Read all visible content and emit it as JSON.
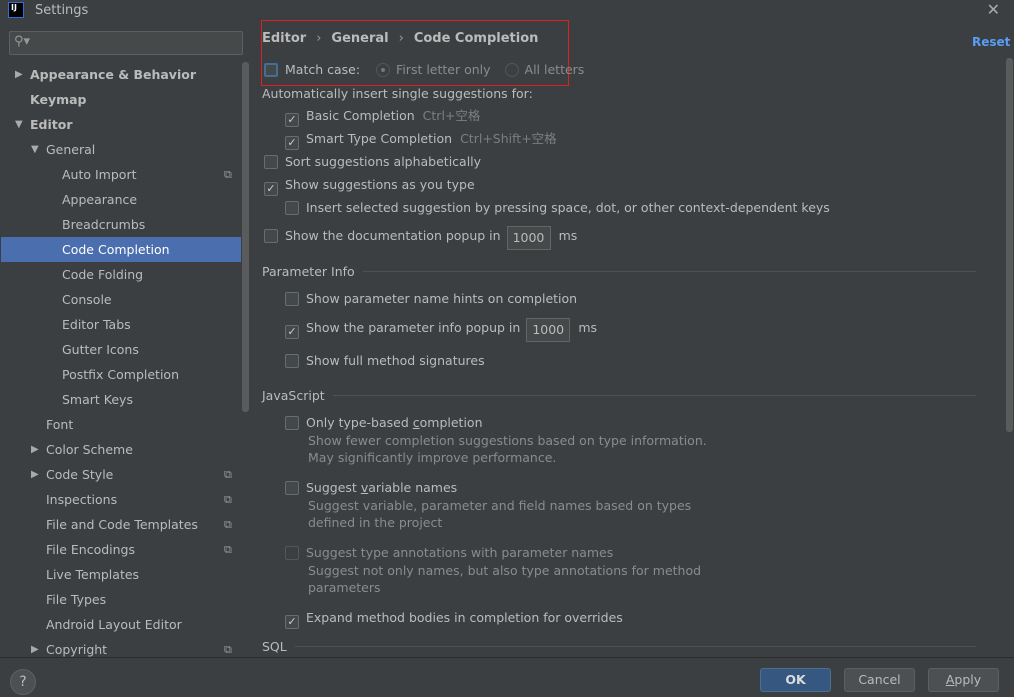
{
  "window": {
    "title": "Settings",
    "logo": "IJ"
  },
  "sidebar": {
    "search_placeholder": "",
    "items": [
      {
        "label": "Appearance & Behavior",
        "level": 0,
        "bold": true,
        "arrow": "▶"
      },
      {
        "label": "Keymap",
        "level": 0,
        "bold": true
      },
      {
        "label": "Editor",
        "level": 0,
        "bold": true,
        "arrow": "▼"
      },
      {
        "label": "General",
        "level": 1,
        "arrow": "▼"
      },
      {
        "label": "Auto Import",
        "level": 2,
        "copy": true
      },
      {
        "label": "Appearance",
        "level": 2
      },
      {
        "label": "Breadcrumbs",
        "level": 2
      },
      {
        "label": "Code Completion",
        "level": 2,
        "selected": true
      },
      {
        "label": "Code Folding",
        "level": 2
      },
      {
        "label": "Console",
        "level": 2
      },
      {
        "label": "Editor Tabs",
        "level": 2
      },
      {
        "label": "Gutter Icons",
        "level": 2
      },
      {
        "label": "Postfix Completion",
        "level": 2
      },
      {
        "label": "Smart Keys",
        "level": 2
      },
      {
        "label": "Font",
        "level": 1
      },
      {
        "label": "Color Scheme",
        "level": 1,
        "arrow": "▶"
      },
      {
        "label": "Code Style",
        "level": 1,
        "arrow": "▶",
        "copy": true
      },
      {
        "label": "Inspections",
        "level": 1,
        "copy": true
      },
      {
        "label": "File and Code Templates",
        "level": 1,
        "copy": true
      },
      {
        "label": "File Encodings",
        "level": 1,
        "copy": true
      },
      {
        "label": "Live Templates",
        "level": 1
      },
      {
        "label": "File Types",
        "level": 1
      },
      {
        "label": "Android Layout Editor",
        "level": 1
      },
      {
        "label": "Copyright",
        "level": 1,
        "arrow": "▶",
        "copy": true
      }
    ]
  },
  "breadcrumb": [
    "Editor",
    "General",
    "Code Completion"
  ],
  "breadcrumb_sep": "›",
  "reset": "Reset",
  "match_case": {
    "label": "Match case:",
    "checked": false,
    "options": [
      "First letter only",
      "All letters"
    ],
    "selected": "First letter only"
  },
  "auto_insert": "Automatically insert single suggestions for:",
  "basic": {
    "label": "Basic Completion",
    "checked": true,
    "shortcut": "Ctrl+空格"
  },
  "smart": {
    "label": "Smart Type Completion",
    "checked": true,
    "shortcut": "Ctrl+Shift+空格"
  },
  "sort": {
    "label": "Sort suggestions alphabetically",
    "checked": false
  },
  "show_as_type": {
    "label": "Show suggestions as you type",
    "checked": true
  },
  "insert_selected": {
    "label": "Insert selected suggestion by pressing space, dot, or other context-dependent keys",
    "checked": false
  },
  "doc_popup": {
    "label": "Show the documentation popup in",
    "checked": false,
    "value": "1000",
    "unit": "ms"
  },
  "param_info": {
    "title": "Parameter Info",
    "hints": {
      "label": "Show parameter name hints on completion",
      "checked": false
    },
    "popup": {
      "label": "Show the parameter info popup in",
      "checked": true,
      "value": "1000",
      "unit": "ms"
    },
    "full_sig": {
      "label": "Show full method signatures",
      "checked": false
    }
  },
  "javascript": {
    "title": "JavaScript",
    "type_based": {
      "label_pre": "Only type-based ",
      "label_u": "c",
      "label_post": "ompletion",
      "checked": false,
      "desc": "Show fewer completion suggestions based on type information. May significantly improve performance."
    },
    "var_names": {
      "label_pre": "Suggest ",
      "label_u": "v",
      "label_post": "ariable names",
      "checked": false,
      "desc": "Suggest variable, parameter and field names based on types defined in the project"
    },
    "type_ann": {
      "label": "Suggest type annotations with parameter names",
      "checked": false,
      "disabled": true,
      "desc": "Suggest not only names, but also type annotations for method parameters"
    },
    "expand": {
      "label": "Expand method bodies in completion for overrides",
      "checked": true
    }
  },
  "sql": {
    "title": "SQL"
  },
  "footer": {
    "help": "?",
    "ok": "OK",
    "cancel": "Cancel",
    "apply_u": "A",
    "apply_rest": "pply"
  },
  "colors": {
    "background": "#3c3f41",
    "selection": "#4b6eaf",
    "link": "#589df6",
    "ok_button": "#365880",
    "highlight_border": "#e02020"
  }
}
